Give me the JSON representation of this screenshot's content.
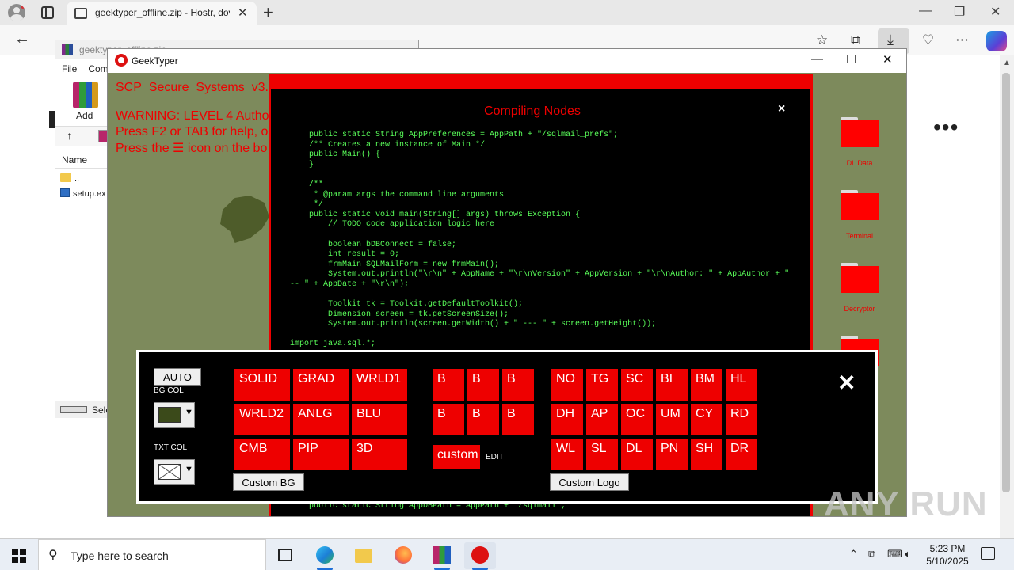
{
  "browser": {
    "tab_title": "geektyper_offline.zip - Hostr, dov",
    "tab_close": "✕",
    "new_tab": "+",
    "minimize": "—",
    "restore": "❐",
    "close": "✕",
    "back": "←",
    "more_dots": "⋯"
  },
  "winrar": {
    "title": "geektyper_offline.zip",
    "menu": [
      "File",
      "Com"
    ],
    "add_label": "Add",
    "up_arrow": "↑",
    "col_name": "Name",
    "rows": [
      "..",
      "setup.ex"
    ],
    "status": "Sele"
  },
  "geektyper": {
    "title": "GeekTyper",
    "min": "—",
    "max": "☐",
    "close": "✕",
    "header_lines": [
      "SCP_Secure_Systems_v3.",
      "WARNING: LEVEL 4 Autho",
      "Press F2 or TAB for help, o",
      "Press the ☰ icon on the bo"
    ],
    "code_window": {
      "title": "Compiling Nodes",
      "close": "×",
      "code": "    public static String AppPreferences = AppPath + \"/sqlmail_prefs\";\n    /** Creates a new instance of Main */\n    public Main() {\n    }\n\n    /**\n     * @param args the command line arguments\n     */\n    public static void main(String[] args) throws Exception {\n        // TODO code application logic here\n\n        boolean bDBConnect = false;\n        int result = 0;\n        frmMain SQLMailForm = new frmMain();\n        System.out.println(\"\\r\\n\" + AppName + \"\\r\\nVersion\" + AppVersion + \"\\r\\nAuthor: \" + AppAuthor + \"\n-- \" + AppDate + \"\\r\\n\");\n\n        Toolkit tk = Toolkit.getDefaultToolkit();\n        Dimension screen = tk.getScreenSize();\n        System.out.println(screen.getWidth() + \" --- \" + screen.getHeight());\n\nimport java.sql.*;",
      "code_bottom": "public static String AppDBPath = AppPath + \"/sqlmail\";"
    },
    "desktop_folders": [
      "DL Data",
      "Terminal",
      "Decryptor",
      ""
    ],
    "panel": {
      "auto": "AUTO",
      "bg_col": "BG COL",
      "txt_col": "TXT COL",
      "bg_swatch_color": "#3b4a1a",
      "theme_buttons": [
        "SOLID",
        "GRAD",
        "WRLD1",
        "WRLD2",
        "ANLG",
        "BLU",
        "CMB",
        "PIP",
        "3D"
      ],
      "b_buttons": [
        "B",
        "B",
        "B",
        "B",
        "B",
        "B"
      ],
      "custom": "custom",
      "edit": "EDIT",
      "logo_buttons": [
        "NO",
        "TG",
        "SC",
        "BI",
        "BM",
        "HL",
        "DH",
        "AP",
        "OC",
        "UM",
        "CY",
        "RD",
        "WL",
        "SL",
        "DL",
        "PN",
        "SH",
        "DR"
      ],
      "custom_bg": "Custom BG",
      "custom_logo": "Custom Logo",
      "close": "✕"
    },
    "accent": "#ee0000"
  },
  "taskbar": {
    "search_placeholder": "Type here to search",
    "time": "5:23 PM",
    "date": "5/10/2025",
    "chevron": "⌃"
  },
  "watermark": "ANY RUN"
}
